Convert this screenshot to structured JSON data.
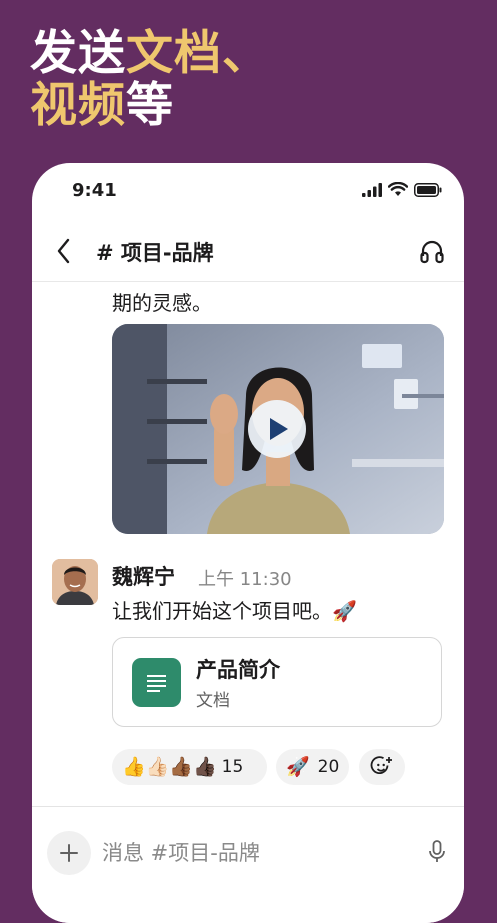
{
  "promo": {
    "headline_gold_1": "文档、",
    "headline_white_1": "发送",
    "headline_gold_2": "视频",
    "headline_white_2": "等"
  },
  "status_bar": {
    "time": "9:41",
    "icons": [
      "signal-icon",
      "wifi-icon",
      "battery-icon"
    ]
  },
  "header": {
    "channel": "# 项目-品牌",
    "back_icon": "chevron-left-icon",
    "huddle_icon": "headphones-icon"
  },
  "messages": {
    "prev_text_tail": "期的灵感。",
    "video": {
      "play_icon": "play-icon"
    },
    "author": "魏辉宁",
    "timestamp": "上午 11:30",
    "text": "让我们开始这个项目吧。🚀"
  },
  "attachment": {
    "title": "产品简介",
    "subtitle": "文档",
    "icon": "document-icon"
  },
  "reactions": [
    {
      "emojis": "👍👍🏻👍🏾👍🏿",
      "count": "15"
    },
    {
      "emojis": "🚀",
      "count": "20"
    }
  ],
  "add_reaction_icon": "add-emoji-icon",
  "composer": {
    "placeholder": "消息 #项目-品牌",
    "plus_icon": "plus-icon",
    "mic_icon": "microphone-icon"
  },
  "colors": {
    "background": "#632d61",
    "headline_gold": "#efc76e",
    "doc_icon": "#2e8b6b"
  }
}
